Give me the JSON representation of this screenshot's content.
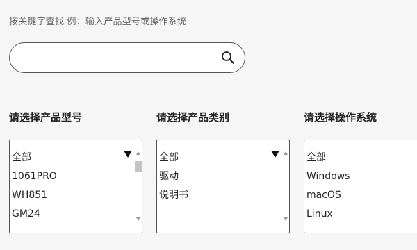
{
  "search": {
    "hint": "按关键字查找  例：输入产品型号或操作系统",
    "placeholder": "",
    "value": "",
    "icon": "search-icon"
  },
  "filters": [
    {
      "label": "请选择产品型号",
      "options": [
        "全部",
        "1061PRO",
        "WH851",
        "GM24"
      ]
    },
    {
      "label": "请选择产品类别",
      "options": [
        "全部",
        "驱动",
        "说明书"
      ]
    },
    {
      "label": "请选择操作系统",
      "options": [
        "全部",
        "Windows",
        "macOS",
        "Linux"
      ]
    }
  ]
}
